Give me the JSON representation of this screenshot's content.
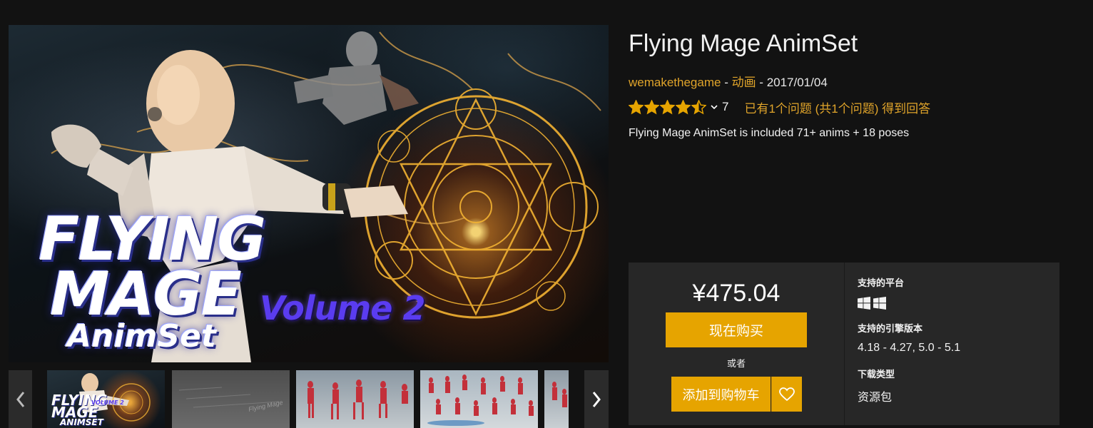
{
  "product": {
    "title": "Flying Mage AnimSet",
    "seller": "wemakethegame",
    "sep1": " - ",
    "category": "动画",
    "sep2": " - ",
    "date": "2017/01/04",
    "rating": 4.5,
    "rating_max": 5,
    "rating_count": "7",
    "questions_link": "已有1个问题 (共1个问题) 得到回答",
    "summary": "Flying Mage AnimSet is included 71+ anims + 18 poses"
  },
  "hero": {
    "line1": "FLYING",
    "line2": "MAGE",
    "line3": "AnimSet",
    "volume": "Volume 2"
  },
  "thumbnails": {
    "active_index": 0,
    "items": [
      {
        "caption1": "FLYING",
        "caption2": "MAGE",
        "caption3": "ANIMSET",
        "caption_vol": "VOLUME 2"
      },
      {
        "caption1": "Flying Mage"
      },
      {},
      {},
      {}
    ]
  },
  "purchase": {
    "price": "¥475.04",
    "buy_now_label": "现在购买",
    "or_label": "或者",
    "add_to_cart_label": "添加到购物车",
    "platforms_heading": "支持的平台",
    "platform_icons": [
      "windows-icon",
      "windows-icon"
    ],
    "engine_heading": "支持的引擎版本",
    "engine_versions": "4.18 - 4.27, 5.0 - 5.1",
    "download_heading": "下载类型",
    "download_type": "资源包"
  },
  "colors": {
    "accent": "#e6a400",
    "link": "#e0a42a",
    "background": "#121212",
    "panel": "#272727",
    "star": "#e6a400"
  },
  "icons": {
    "prev": "chevron-left-icon",
    "next": "chevron-right-icon",
    "wishlist": "heart-icon",
    "rating_dropdown": "chevron-down-icon"
  }
}
